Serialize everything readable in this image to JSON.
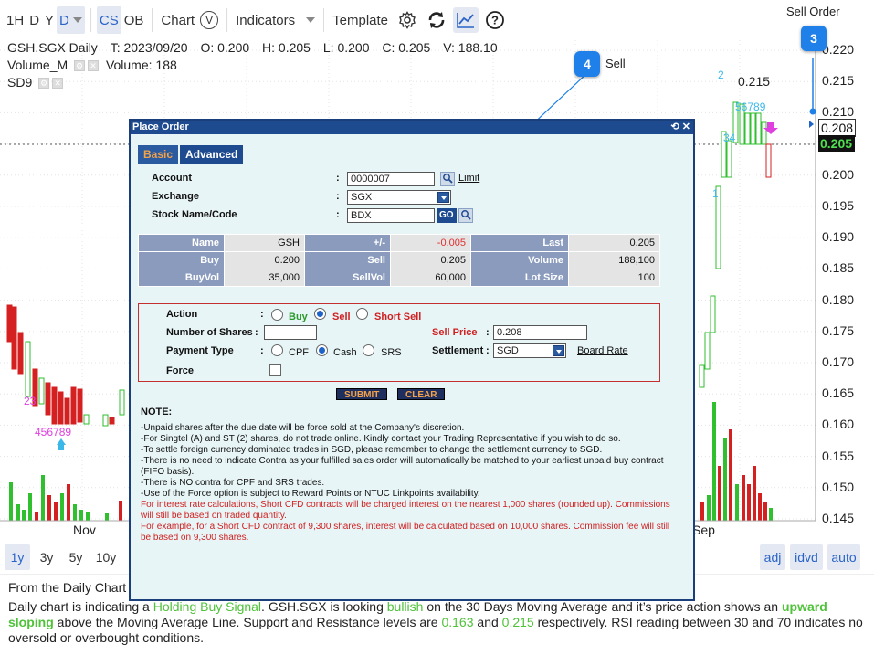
{
  "toolbar": {
    "timeframes": [
      "1H",
      "D",
      "Y"
    ],
    "active_timeframe": "D",
    "cs_label": "CS",
    "ob_label": "OB",
    "chart_label": "Chart",
    "chart_icon_letter": "V",
    "indicators_label": "Indicators",
    "template_label": "Template"
  },
  "chart": {
    "info_line1": {
      "symbol": "GSH.SGX Daily",
      "t": "T: 2023/09/20",
      "o": "O: 0.200",
      "h": "H: 0.205",
      "l": "L: 0.200",
      "c": "C: 0.205",
      "v": "V: 188.10"
    },
    "info_line2": {
      "name": "Volume_M",
      "value": "Volume: 188"
    },
    "info_line3": {
      "name": "SD9"
    },
    "y_ticks": [
      "0.220",
      "0.215",
      "0.210",
      "0.205",
      "0.200",
      "0.195",
      "0.190",
      "0.185",
      "0.180",
      "0.175",
      "0.170",
      "0.165",
      "0.160",
      "0.155",
      "0.150",
      "0.145"
    ],
    "price_marker_sell": "0.208",
    "price_marker_last": "0.205",
    "x_ticks": [
      "Nov",
      "Sep"
    ],
    "labels": {
      "twenty_three": "23",
      "four56789_left": "456789",
      "two": "2",
      "peak": "0.215",
      "four56789_right": "56789",
      "thirty_four": "34",
      "one": "1"
    },
    "colors": {
      "up": "#2fbf2f",
      "down": "#d42020",
      "count_pink": "#e040e0",
      "count_cyan": "#3cb8e8"
    }
  },
  "callouts": [
    {
      "number": "3",
      "text": "Sell Order"
    },
    {
      "number": "4",
      "text": "Sell"
    }
  ],
  "dialog": {
    "title": "Place Order",
    "controls": "⟲ ✕",
    "tabs": [
      "Basic",
      "Advanced"
    ],
    "account": {
      "label": "Account",
      "value": "0000007",
      "link": "Limit"
    },
    "exchange": {
      "label": "Exchange",
      "value": "SGX"
    },
    "stock": {
      "label": "Stock Name/Code",
      "value": "BDX",
      "go": "GO"
    },
    "quote": {
      "rows": [
        [
          {
            "h": "Name"
          },
          {
            "v": "GSH"
          },
          {
            "h": "+/-"
          },
          {
            "v": "-0.005",
            "neg": true
          },
          {
            "h": "Last"
          },
          {
            "v": "0.205"
          }
        ],
        [
          {
            "h": "Buy"
          },
          {
            "v": "0.200"
          },
          {
            "h": "Sell"
          },
          {
            "v": "0.205"
          },
          {
            "h": "Volume"
          },
          {
            "v": "188,100"
          }
        ],
        [
          {
            "h": "BuyVol"
          },
          {
            "v": "35,000"
          },
          {
            "h": "SellVol"
          },
          {
            "v": "60,000"
          },
          {
            "h": "Lot Size"
          },
          {
            "v": "100"
          }
        ]
      ]
    },
    "action": {
      "label": "Action",
      "options": [
        "Buy",
        "Sell",
        "Short Sell"
      ],
      "selected": "Sell"
    },
    "shares": {
      "label": "Number of Shares",
      "value": ""
    },
    "sell_price": {
      "label": "Sell Price",
      "value": "0.208"
    },
    "payment": {
      "label": "Payment Type",
      "options": [
        "CPF",
        "Cash",
        "SRS"
      ],
      "selected": "Cash"
    },
    "settlement": {
      "label": "Settlement",
      "value": "SGD",
      "link": "Board Rate"
    },
    "force": {
      "label": "Force"
    },
    "submit_label": "SUBMIT",
    "clear_label": "CLEAR",
    "note_title": "NOTE:",
    "notes": [
      {
        "text": "-Unpaid shares after the due date will be force sold at the Company's discretion.",
        "red": false
      },
      {
        "text": "-For Singtel (A) and ST (2) shares, do not trade online. Kindly contact your Trading Representative if you wish to do so.",
        "red": false
      },
      {
        "text": "-To settle foreign currency dominated trades in SGD, please remember to change the settlement currency to SGD.",
        "red": false
      },
      {
        "text": "-There is no need to indicate Contra as your fulfilled sales order will automatically be matched to your earliest unpaid buy contract (FIFO basis).",
        "red": false
      },
      {
        "text": "-There is NO contra for CPF and SRS trades.",
        "red": false
      },
      {
        "text": "-Use of the Force option is subject to Reward Points or NTUC Linkpoints availability.",
        "red": false
      },
      {
        "text": "For interest rate calculations, Short CFD contracts will be charged interest on the nearest 1,000 shares (rounded up). Commissions will still be based on traded quantity.",
        "red": true
      },
      {
        "text": "For example, for a Short CFD contract of 9,300 shares, interest will be calculated based on 10,000 shares. Commission fee will still be based on 9,300 shares.",
        "red": true
      }
    ]
  },
  "range_bar": {
    "ranges": [
      "1y",
      "3y",
      "5y",
      "10y"
    ],
    "active": "1y",
    "right": [
      "adj",
      "idvd",
      "auto"
    ]
  },
  "description": {
    "line0": "From the Daily Chart",
    "p1": "Daily chart is indicating a ",
    "signal": "Holding Buy Signal",
    "p2": ". GSH.SGX is looking ",
    "bullish": "bullish",
    "p3": " on the 30 Days Moving Average and it’s price action shows an ",
    "upward": "upward sloping",
    "p4": " above the Moving Average Line. Support and Resistance levels are ",
    "support": "0.163",
    "p5": " and ",
    "resistance": "0.215",
    "p6": " respectively. RSI reading between 30 and 70 indicates no oversold or overbought conditions."
  }
}
